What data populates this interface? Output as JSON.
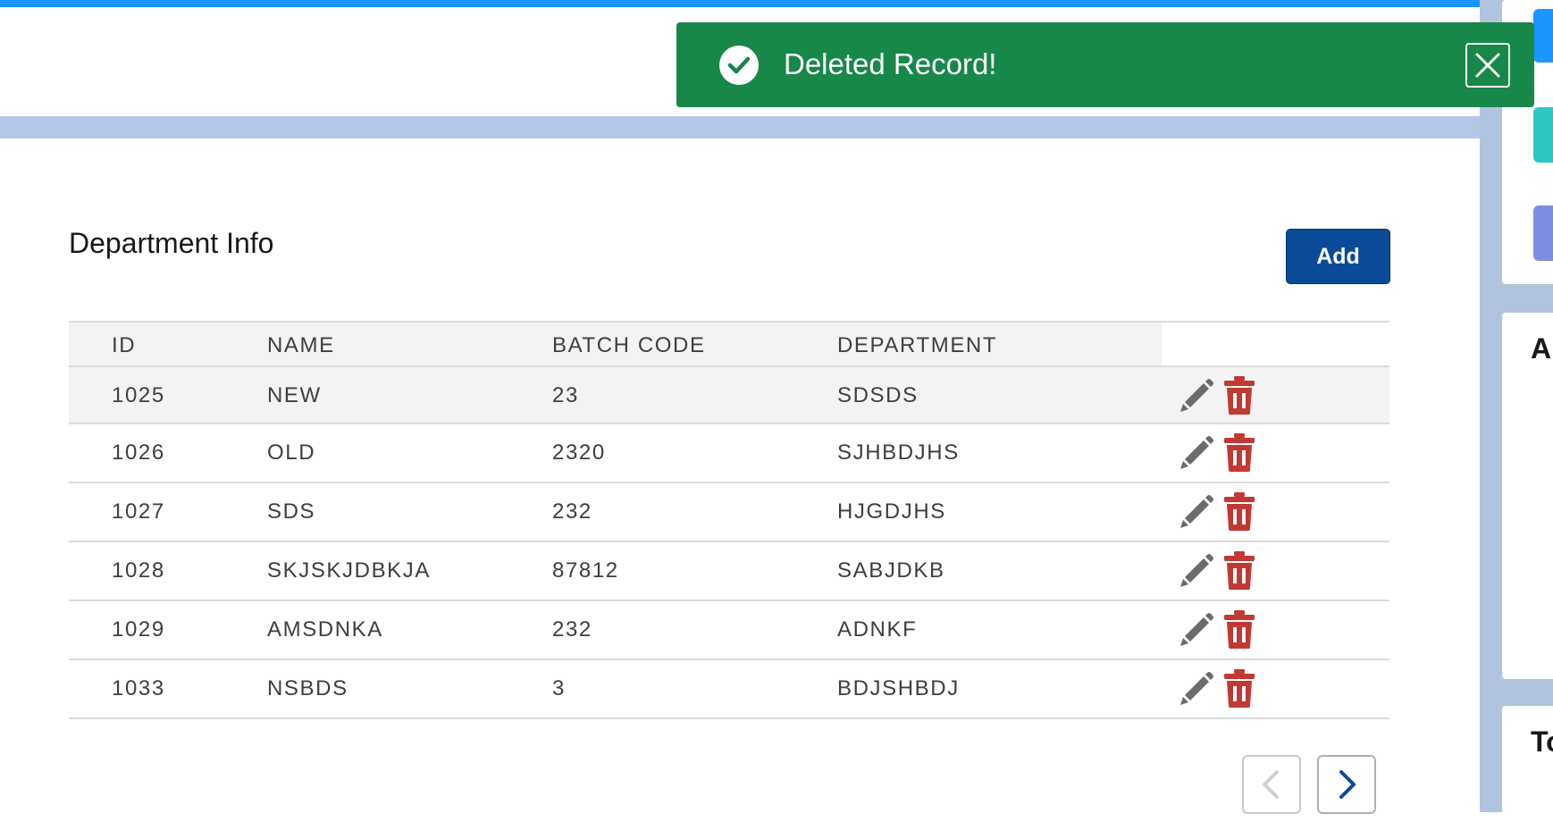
{
  "toast": {
    "message": "Deleted Record!",
    "status_color": "#17874a"
  },
  "card": {
    "title": "Department Info",
    "add_label": "Add"
  },
  "table": {
    "headers": [
      "ID",
      "NAME",
      "BATCH CODE",
      "DEPARTMENT"
    ],
    "rows": [
      {
        "id": "1025",
        "name": "NEW",
        "batch_code": "23",
        "department": "SDSDS"
      },
      {
        "id": "1026",
        "name": "OLD",
        "batch_code": "2320",
        "department": "SJHBDJHS"
      },
      {
        "id": "1027",
        "name": "SDS",
        "batch_code": "232",
        "department": "HJGDJHS"
      },
      {
        "id": "1028",
        "name": "SKJSKJDBKJA",
        "batch_code": "87812",
        "department": "SABJDKB"
      },
      {
        "id": "1029",
        "name": "AMSDNKA",
        "batch_code": "232",
        "department": "ADNKF"
      },
      {
        "id": "1033",
        "name": "NSBDS",
        "batch_code": "3",
        "department": "BDJSHBDJ"
      }
    ],
    "row_actions": [
      "pencil-icon",
      "trash-icon"
    ],
    "delete_color": "#c23934"
  },
  "pagination": {
    "prev_icon": "chevron-left-icon",
    "next_icon": "chevron-right-icon"
  },
  "sidebar": {
    "letters": [
      "A",
      "To"
    ]
  }
}
